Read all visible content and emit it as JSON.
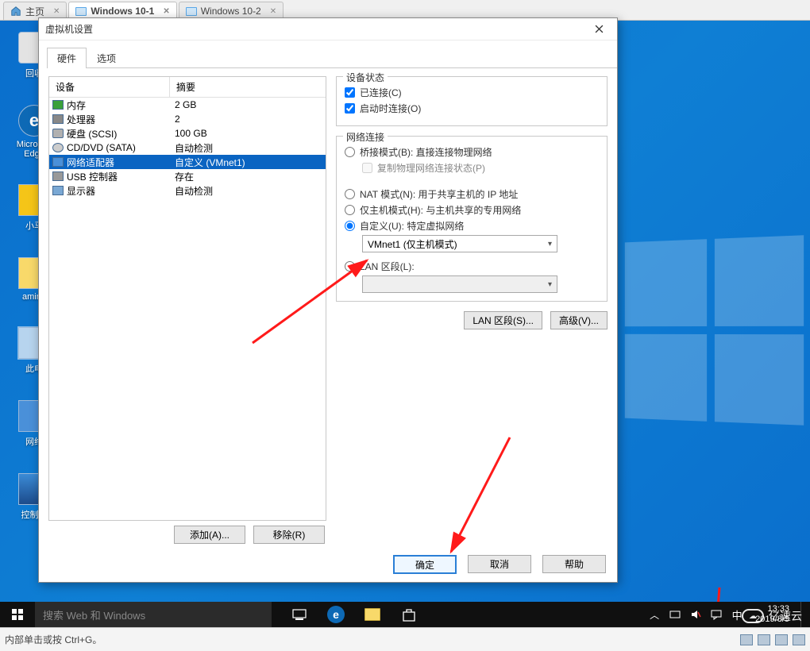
{
  "tabs": [
    {
      "label": "主页",
      "active": false
    },
    {
      "label": "Windows 10-1",
      "active": true
    },
    {
      "label": "Windows 10-2",
      "active": false
    }
  ],
  "desktop": {
    "icons": [
      {
        "label": "回收",
        "type": "recycle"
      },
      {
        "label": "Microsoft Edge",
        "type": "edge"
      },
      {
        "label": "小马",
        "type": "horse"
      },
      {
        "label": "aming",
        "type": "folder"
      },
      {
        "label": "此电",
        "type": "pc",
        "selected": true
      },
      {
        "label": "网络",
        "type": "net"
      },
      {
        "label": "控制面",
        "type": "cp"
      }
    ]
  },
  "dialog": {
    "title": "虚拟机设置",
    "tabs": {
      "hardware": "硬件",
      "options": "选项"
    },
    "columns": {
      "device": "设备",
      "summary": "摘要"
    },
    "devices": [
      {
        "name": "内存",
        "summary": "2 GB",
        "ico": "mem"
      },
      {
        "name": "处理器",
        "summary": "2",
        "ico": "cpu"
      },
      {
        "name": "硬盘 (SCSI)",
        "summary": "100 GB",
        "ico": "hdd"
      },
      {
        "name": "CD/DVD (SATA)",
        "summary": "自动检测",
        "ico": "cd"
      },
      {
        "name": "网络适配器",
        "summary": "自定义 (VMnet1)",
        "ico": "net",
        "selected": true
      },
      {
        "name": "USB 控制器",
        "summary": "存在",
        "ico": "usb"
      },
      {
        "name": "显示器",
        "summary": "自动检测",
        "ico": "disp"
      }
    ],
    "add_btn": "添加(A)...",
    "remove_btn": "移除(R)",
    "state": {
      "legend": "设备状态",
      "connected": "已连接(C)",
      "connect_at_poweron": "启动时连接(O)"
    },
    "network": {
      "legend": "网络连接",
      "bridged": "桥接模式(B): 直接连接物理网络",
      "replicate": "复制物理网络连接状态(P)",
      "nat": "NAT 模式(N): 用于共享主机的 IP 地址",
      "hostonly": "仅主机模式(H): 与主机共享的专用网络",
      "custom": "自定义(U): 特定虚拟网络",
      "custom_value": "VMnet1 (仅主机模式)",
      "lanseg": "LAN 区段(L):"
    },
    "lanseg_btn": "LAN 区段(S)...",
    "advanced_btn": "高级(V)...",
    "ok": "确定",
    "cancel": "取消",
    "help": "帮助"
  },
  "taskbar": {
    "search_placeholder": "搜索 Web 和 Windows",
    "ime": "中",
    "time": "13:33",
    "date": "2019/8/5"
  },
  "statusbar": {
    "hint": "内部单击或按 Ctrl+G。"
  },
  "watermark": "亿速云"
}
